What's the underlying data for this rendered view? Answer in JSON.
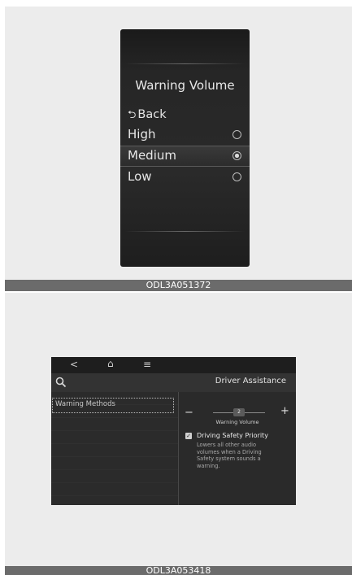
{
  "top_figure": {
    "cluster": {
      "title": "Warning Volume",
      "back": {
        "icon": "return-arrow-icon",
        "label": "Back"
      },
      "options": [
        {
          "label": "High",
          "selected": false
        },
        {
          "label": "Medium",
          "selected": true
        },
        {
          "label": "Low",
          "selected": false
        }
      ]
    },
    "caption": "ODL3A051372"
  },
  "bottom_figure": {
    "topbar": {
      "back_glyph": "<",
      "home_glyph": "⌂",
      "menu_glyph": "≡"
    },
    "header": {
      "title": "Driver Assistance"
    },
    "left_menu": {
      "selected_item": "Warning Methods"
    },
    "volume": {
      "minus": "−",
      "plus": "+",
      "level_text": "2",
      "label": "Warning Volume"
    },
    "priority": {
      "checked": true,
      "label": "Driving Safety Priority",
      "description": "Lowers all other audio\nvolumes when a Driving\nSafety system sounds a\nwarning."
    },
    "caption": "ODL3A053418"
  },
  "colors": {
    "page_bg": "#ececec",
    "caption_bar": "#6b6b6b",
    "screen_bg": "#2b2b2b"
  }
}
